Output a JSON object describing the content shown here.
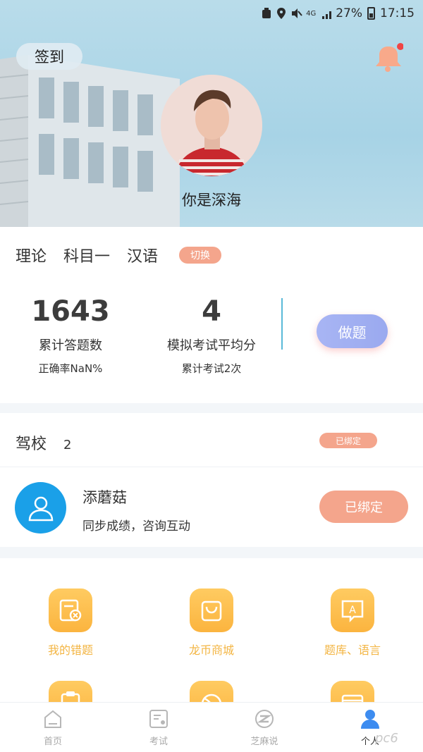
{
  "status_bar": {
    "network": "4G",
    "battery": "27%",
    "time": "17:15"
  },
  "header": {
    "signin_label": "签到",
    "username": "你是深海"
  },
  "theory": {
    "tabs": [
      "理论",
      "科目一",
      "汉语"
    ],
    "switch_label": "切换",
    "stats": [
      {
        "value": "1643",
        "label": "累计答题数",
        "sub": "正确率NaN%"
      },
      {
        "value": "4",
        "label": "模拟考试平均分",
        "sub": "累计考试2次"
      }
    ],
    "do_label": "做题"
  },
  "school": {
    "title": "驾校",
    "count": "2",
    "badge": "已绑定",
    "coach_name": "添蘑菇",
    "coach_desc": "同步成绩，咨询互动",
    "bound_button": "已绑定"
  },
  "grid": {
    "items": [
      {
        "label": "我的错题",
        "icon": "wrong-questions-icon"
      },
      {
        "label": "龙币商城",
        "icon": "shopping-bag-icon"
      },
      {
        "label": "题库、语言",
        "icon": "question-bank-icon"
      }
    ]
  },
  "tabbar": {
    "items": [
      {
        "label": "首页",
        "icon": "home-icon"
      },
      {
        "label": "考试",
        "icon": "exam-icon"
      },
      {
        "label": "芝麻说",
        "icon": "zhima-icon"
      },
      {
        "label": "个人",
        "icon": "person-icon"
      }
    ]
  },
  "watermark": "pc6"
}
